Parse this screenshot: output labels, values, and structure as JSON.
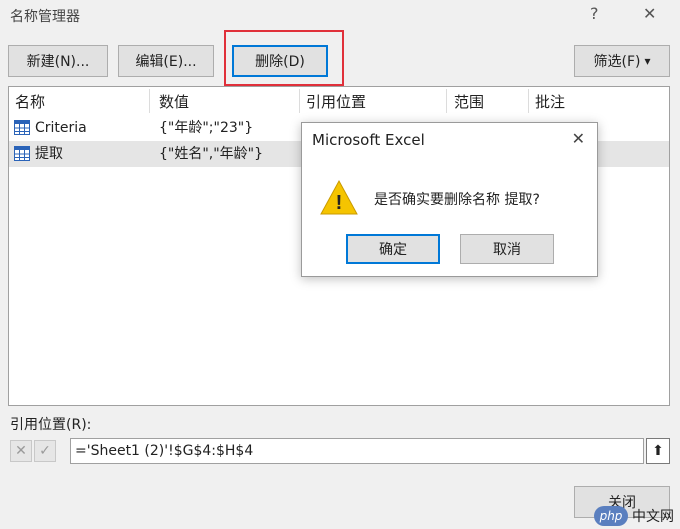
{
  "window": {
    "title": "名称管理器",
    "help": "?",
    "close": "✕"
  },
  "toolbar": {
    "new_label": "新建(N)...",
    "edit_label": "编辑(E)...",
    "delete_label": "删除(D)",
    "filter_label": "筛选(F)",
    "filter_arrow": "▾"
  },
  "list": {
    "headers": [
      "名称",
      "数值",
      "引用位置",
      "范围",
      "批注"
    ],
    "rows": [
      {
        "name": "Criteria",
        "value": "{\"年龄\";\"23\"}"
      },
      {
        "name": "提取",
        "value": "{\"姓名\",\"年龄\"}"
      }
    ]
  },
  "refers_to": {
    "label": "引用位置(R):",
    "value": "='Sheet1 (2)'!$G$4:$H$4",
    "cancel_icon": "✕",
    "confirm_icon": "✓",
    "pick_icon": "⬆"
  },
  "close_button": "关闭",
  "dialog": {
    "title": "Microsoft Excel",
    "close": "✕",
    "message": "是否确实要删除名称 提取?",
    "ok_label": "确定",
    "cancel_label": "取消",
    "warning_icon": "!"
  },
  "watermark": {
    "logo": "php",
    "text": "中文网"
  },
  "colors": {
    "highlight_border": "#e0303a",
    "focus_border": "#0078d7",
    "warning_fill": "#f5c400"
  }
}
